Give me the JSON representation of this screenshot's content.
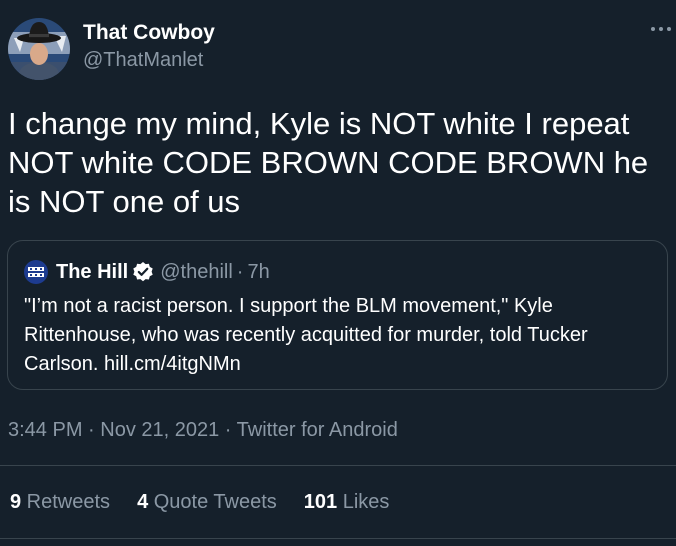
{
  "author": {
    "display_name": "That Cowboy",
    "handle": "@ThatManlet",
    "avatar_icon": "cowboy-hat-avatar"
  },
  "tweet": {
    "text": "I change my mind, Kyle is NOT white I repeat NOT white CODE BROWN CODE BROWN he is NOT one of us"
  },
  "quoted_tweet": {
    "display_name": "The Hill",
    "handle": "@thehill",
    "separator": "·",
    "time": "7h",
    "text": "\"I’m not a racist person. I support the BLM movement,\" Kyle Rittenhouse, who was recently acquitted for murder, told Tucker Carlson. hill.cm/4itgNMn",
    "verified": true
  },
  "meta": {
    "time": "3:44 PM",
    "sep1": " · ",
    "date": "Nov 21, 2021",
    "sep2": " · ",
    "source": "Twitter for Android"
  },
  "stats": {
    "retweets_count": "9",
    "retweets_label": " Retweets",
    "quotes_count": "4",
    "quotes_label": " Quote Tweets",
    "likes_count": "101",
    "likes_label": " Likes"
  },
  "colors": {
    "background": "#15202b",
    "text": "#ffffff",
    "secondary_text": "#8b98a5",
    "border": "#38444d",
    "verified": "#1d9bf0"
  }
}
